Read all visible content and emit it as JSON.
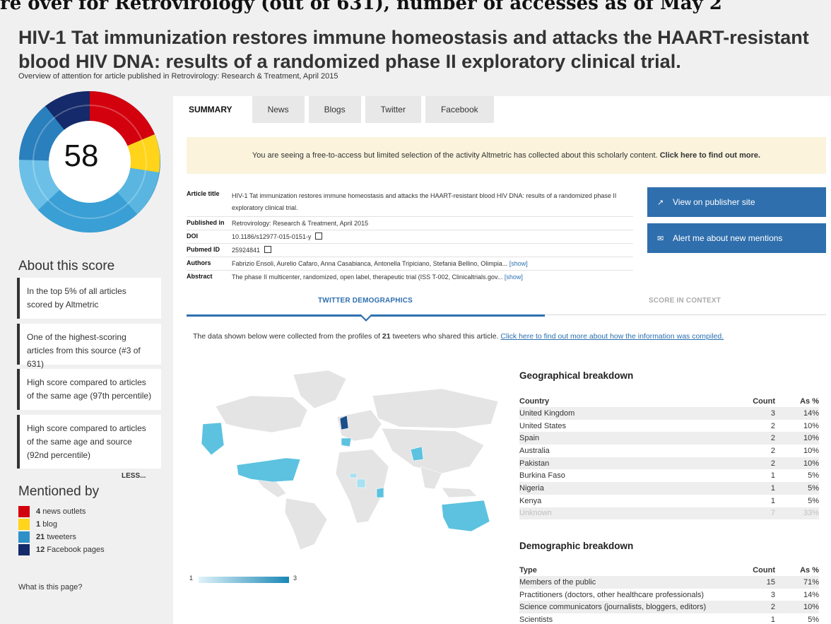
{
  "banner_text": "re over for Retrovirology (out of 631), number of accesses as of May 2",
  "article_title": "HIV-1 Tat immunization restores immune homeostasis and attacks the HAART-resistant blood HIV DNA: results of a randomized phase II exploratory clinical trial.",
  "subtitle": "Overview of attention for article published in Retrovirology: Research & Treatment, April 2015",
  "score": "58",
  "colors": {
    "news": "#d3000d",
    "blog": "#ffd41a",
    "twitter": "#2f90c8",
    "facebook": "#152a6a",
    "accent": "#2f6fad"
  },
  "about": {
    "heading": "About this score",
    "items": [
      "In the top 5% of all articles scored by Altmetric",
      "One of the highest-scoring articles from this source (#3 of 631)",
      "High score compared to articles of the same age (97th percentile)",
      "High score compared to articles of the same age and source (92nd percentile)"
    ],
    "less_label": "LESS..."
  },
  "mentioned": {
    "heading": "Mentioned by",
    "items": [
      {
        "count": "4",
        "label": "news outlets"
      },
      {
        "count": "1",
        "label": "blog"
      },
      {
        "count": "21",
        "label": "tweeters"
      },
      {
        "count": "12",
        "label": "Facebook pages"
      }
    ]
  },
  "what_link": "What is this page?",
  "tabs": [
    "SUMMARY",
    "News",
    "Blogs",
    "Twitter",
    "Facebook"
  ],
  "notice": {
    "text": "You are seeing a free-to-access but limited selection of the activity Altmetric has collected about this scholarly content.",
    "link": "Click here to find out more."
  },
  "meta": {
    "article_title_label": "Article title",
    "article_title_value": "HIV-1 Tat immunization restores immune homeostasis and attacks the HAART-resistant blood HIV DNA: results of a randomized phase II exploratory clinical trial.",
    "published_label": "Published in",
    "published_value": "Retrovirology: Research & Treatment, April 2015",
    "doi_label": "DOI",
    "doi_value": "10.1186/s12977-015-0151-y",
    "pubmed_label": "Pubmed ID",
    "pubmed_value": "25924841",
    "authors_label": "Authors",
    "authors_value": "Fabrizio Ensoli, Aurelio Cafaro, Anna Casabianca, Antonella Tripiciano, Stefania Bellino, Olimpia...",
    "abstract_label": "Abstract",
    "abstract_value": "The phase II multicenter, randomized, open label, therapeutic trial (ISS T-002, Clinicaltrials.gov...",
    "show_label": "[show]"
  },
  "buttons": {
    "publisher": "View on publisher site",
    "alert": "Alert me about new mentions"
  },
  "demo_tabs": {
    "twitter": "TWITTER DEMOGRAPHICS",
    "context": "SCORE IN CONTEXT"
  },
  "demo_intro": {
    "before": "The data shown below were collected from the profiles of ",
    "count": "21",
    "after": " tweeters who shared this article. ",
    "link": "Click here to find out more about how the information was compiled."
  },
  "map_legend": {
    "min": "1",
    "max": "3"
  },
  "geo": {
    "heading": "Geographical breakdown",
    "columns": [
      "Country",
      "Count",
      "As %"
    ],
    "rows": [
      [
        "United Kingdom",
        "3",
        "14%"
      ],
      [
        "United States",
        "2",
        "10%"
      ],
      [
        "Spain",
        "2",
        "10%"
      ],
      [
        "Australia",
        "2",
        "10%"
      ],
      [
        "Pakistan",
        "2",
        "10%"
      ],
      [
        "Burkina Faso",
        "1",
        "5%"
      ],
      [
        "Nigeria",
        "1",
        "5%"
      ],
      [
        "Kenya",
        "1",
        "5%"
      ],
      [
        "Unknown",
        "7",
        "33%"
      ]
    ]
  },
  "demographic": {
    "heading": "Demographic breakdown",
    "columns": [
      "Type",
      "Count",
      "As %"
    ],
    "rows": [
      [
        "Members of the public",
        "15",
        "71%"
      ],
      [
        "Practitioners (doctors, other healthcare professionals)",
        "3",
        "14%"
      ],
      [
        "Science communicators (journalists, bloggers, editors)",
        "2",
        "10%"
      ],
      [
        "Scientists",
        "1",
        "5%"
      ]
    ]
  }
}
